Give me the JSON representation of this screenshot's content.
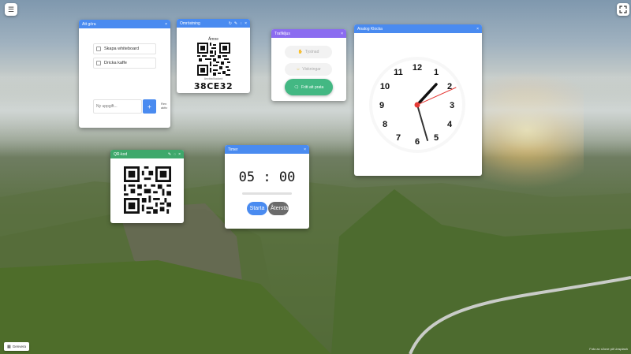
{
  "todo": {
    "title": "Att göra",
    "items": [
      {
        "label": "Skapa whiteboard"
      },
      {
        "label": "Dricka kaffe"
      }
    ],
    "input_placeholder": "Ny uppgift...",
    "add_label": "+",
    "side_text": "Ren aktiv"
  },
  "random": {
    "title": "Omröstning",
    "subject_label": "Ämne",
    "scan_text": "Använd kodord",
    "code": "38CE32"
  },
  "traffic": {
    "title": "Trafikljus",
    "options": [
      {
        "label": "Tystnad"
      },
      {
        "label": "Viskningar"
      },
      {
        "label": "Fritt att prata"
      }
    ],
    "colors": {
      "red": "#f2f2f2",
      "yellow": "#f2f2f2",
      "green": "#43b883"
    }
  },
  "clock": {
    "title": "Analog Klocka",
    "numbers": [
      "12",
      "1",
      "2",
      "3",
      "4",
      "5",
      "6",
      "7",
      "8",
      "9",
      "10",
      "11"
    ]
  },
  "qr": {
    "title": "QR-kod"
  },
  "timer": {
    "title": "Timer",
    "display": "05 : 00",
    "start_label": "Starta",
    "reset_label": "Återställ"
  },
  "footer": {
    "widgets_button": "Genvera",
    "credit": "Foto av x2one på Unsplash"
  },
  "colors": {
    "blue": "#4a8bf0",
    "purple": "#8b6cf0",
    "green": "#3ea86b"
  }
}
